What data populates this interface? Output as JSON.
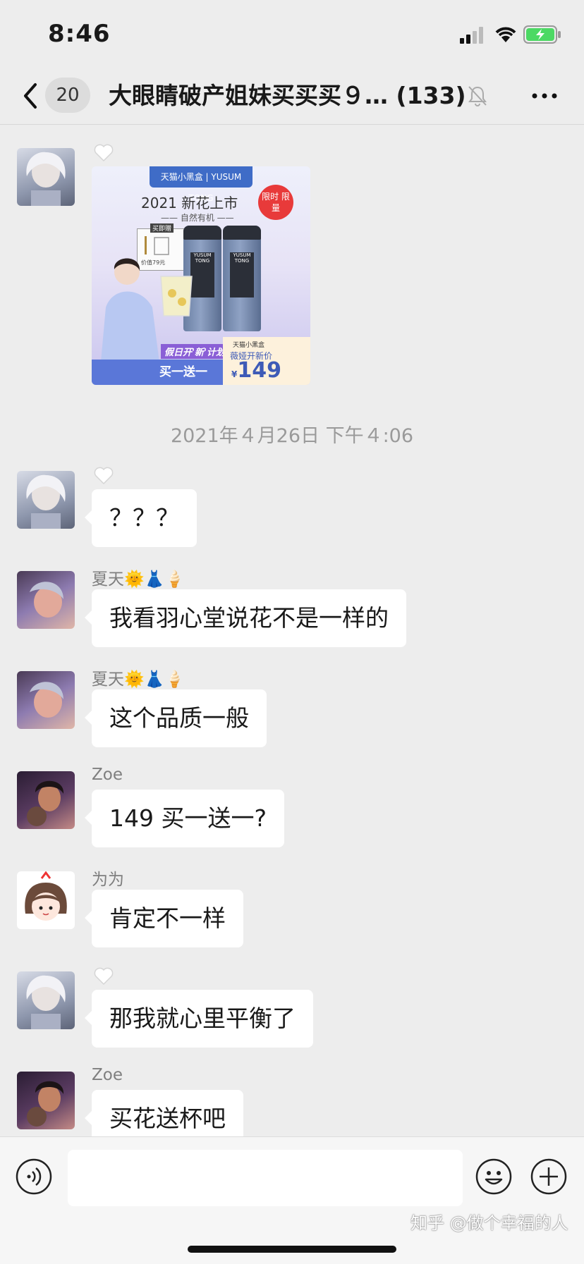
{
  "status_bar": {
    "time": "8:46"
  },
  "nav": {
    "back_badge": "20",
    "title": "大眼睛破产姐妹买买买９… (133)"
  },
  "product_image": {
    "header": "天猫小黑盒 | YUSUM TONG",
    "title": "2021 新花上市",
    "subtitle": "—— 自然有机 ——",
    "badge": "限时 限量",
    "gift_label": "买即赠",
    "gift_price": "价值79元",
    "can_text": "YUSUM TONG",
    "promo_line1": "假日开'新'计划",
    "promo_line2": "买一送一",
    "store": "天猫小黑盒",
    "new_price_label": "薇娅开新价",
    "currency": "¥",
    "price": "149"
  },
  "timestamp": "2021年４月26日 下午４:06",
  "messages": [
    {
      "sender": "",
      "text": "？？？"
    },
    {
      "sender": "夏天🌞👗🍦",
      "text": "我看羽心堂说花不是一样的"
    },
    {
      "sender": "夏天🌞👗🍦",
      "text": "这个品质一般"
    },
    {
      "sender": "Zoe",
      "text": "149 买一送一?"
    },
    {
      "sender": "为为",
      "text": "肯定不一样"
    },
    {
      "sender": "",
      "text": "那我就心里平衡了"
    },
    {
      "sender": "Zoe",
      "text": "买花送杯吧"
    }
  ],
  "input": {
    "placeholder": ""
  },
  "watermark": "知乎 @做个幸福的人",
  "colors": {
    "background": "#ededed",
    "bubble": "#ffffff",
    "battery": "#4cd964",
    "price_blue": "#3e5bb7"
  },
  "icons": [
    "signal-icon",
    "wifi-icon",
    "battery-icon",
    "back-icon",
    "mute-icon",
    "more-icon",
    "heart-icon",
    "voice-icon",
    "emoji-icon",
    "plus-icon"
  ]
}
